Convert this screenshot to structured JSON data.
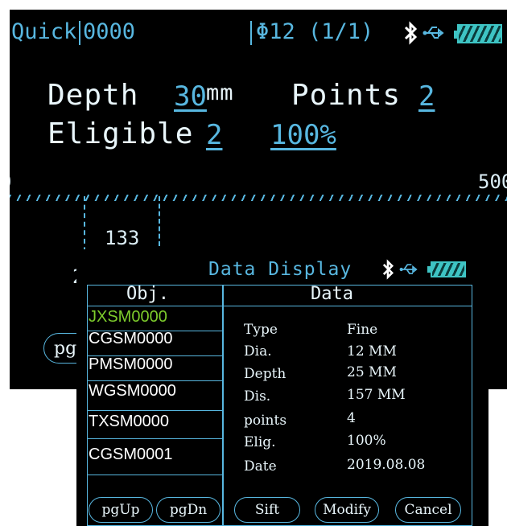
{
  "colors": {
    "accent": "#58b7e0",
    "battery": "#3ec4c4",
    "selected": "#7dcc2c",
    "background": "#000000"
  },
  "status": {
    "mode": "Quick",
    "code": "0000",
    "diameter": "Φ12 (1/1)",
    "icons": [
      "bluetooth-icon",
      "usb-icon",
      "battery-icon"
    ]
  },
  "main": {
    "depth_label": "Depth",
    "depth_value": "30",
    "depth_unit": "mm",
    "points_label": "Points",
    "points_value": "2",
    "eligible_label": "Eligible",
    "eligible_value": "2",
    "eligible_percent": "100%"
  },
  "scale": {
    "min_label": "0",
    "max_label": "500",
    "distance_label": "133",
    "marker_label": "2",
    "marker_positions": [
      0,
      133
    ]
  },
  "background_button": "pg",
  "dialog": {
    "title": "Data Display",
    "icons": [
      "bluetooth-icon",
      "usb-icon",
      "battery-icon"
    ],
    "obj_header": "Obj.",
    "data_header": "Data",
    "objects": [
      "JXSM0000",
      "CGSM0000",
      "PMSM0000",
      "WGSM0000",
      "TXSM0000",
      "CGSM0001"
    ],
    "selected_index": 0,
    "fields": [
      {
        "label": "Type",
        "value": "Fine"
      },
      {
        "label": "Dia.",
        "value": "12 MM"
      },
      {
        "label": "Depth",
        "value": "25 MM"
      },
      {
        "label": "Dis.",
        "value": "157 MM"
      },
      {
        "label": "points",
        "value": "4"
      },
      {
        "label": "Elig.",
        "value": "100%"
      },
      {
        "label": "Date",
        "value": "2019.08.08"
      }
    ],
    "buttons": {
      "pgup": "pgUp",
      "pgdn": "pgDn",
      "sift": "Sift",
      "modify": "Modify",
      "cancel": "Cancel"
    }
  }
}
